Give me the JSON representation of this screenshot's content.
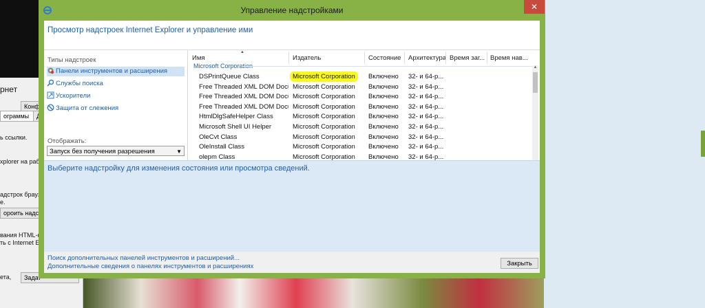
{
  "dialog": {
    "title": "Управление надстройками",
    "heading": "Просмотр надстроек Internet Explorer и управление ими",
    "close_glyph": "✕"
  },
  "left_pane": {
    "title": "Типы надстроек",
    "items": [
      {
        "label": "Панели инструментов и расширения",
        "icon": "gear-icon",
        "selected": true
      },
      {
        "label": "Службы поиска",
        "icon": "search-icon",
        "selected": false
      },
      {
        "label": "Ускорители",
        "icon": "accelerator-icon",
        "selected": false
      },
      {
        "label": "Защита от слежения",
        "icon": "no-entry-icon",
        "selected": false
      }
    ],
    "show_label": "Отображать:",
    "show_value": "Запуск без получения разрешения"
  },
  "table": {
    "columns": [
      "Имя",
      "Издатель",
      "Состояние",
      "Архитектура",
      "Время заг...",
      "Время нав..."
    ],
    "group": "Microsoft Corporation",
    "rows": [
      {
        "name": "DSPrintQueue Class",
        "publisher": "Microsoft Corporation",
        "status": "Включено",
        "arch": "32- и 64-р...",
        "highlight": true
      },
      {
        "name": "Free Threaded XML DOM Docu...",
        "publisher": "Microsoft Corporation",
        "status": "Включено",
        "arch": "32- и 64-р..."
      },
      {
        "name": "Free Threaded XML DOM Docu...",
        "publisher": "Microsoft Corporation",
        "status": "Включено",
        "arch": "32- и 64-р..."
      },
      {
        "name": "Free Threaded XML DOM Docu...",
        "publisher": "Microsoft Corporation",
        "status": "Включено",
        "arch": "32- и 64-р..."
      },
      {
        "name": "HtmlDlgSafeHelper Class",
        "publisher": "Microsoft Corporation",
        "status": "Включено",
        "arch": "32- и 64-р..."
      },
      {
        "name": "Microsoft Shell UI Helper",
        "publisher": "Microsoft Corporation",
        "status": "Включено",
        "arch": "32- и 64-р..."
      },
      {
        "name": "OleCvt Class",
        "publisher": "Microsoft Corporation",
        "status": "Включено",
        "arch": "32- и 64-р..."
      },
      {
        "name": "OleInstall Class",
        "publisher": "Microsoft Corporation",
        "status": "Включено",
        "arch": "32- и 64-р..."
      },
      {
        "name": "olepm Class",
        "publisher": "Microsoft Corporation",
        "status": "Включено",
        "arch": "32- и 64-р..."
      }
    ]
  },
  "details": {
    "message": "Выберите надстройку для изменения состояния или просмотра сведений."
  },
  "footer": {
    "link1": "Поиск дополнительных панелей инструментов и расширений...",
    "link2": "Дополнительные сведения о панелях инструментов и расширениях",
    "close_label": "Закрыть"
  },
  "background_window": {
    "fragments": [
      "рнет",
      "Конфиден",
      "ограммы",
      "Д",
      "ь ссылки.",
      "xplorer на рабо",
      "адстрок браузе",
      "е.",
      "ороить надстро",
      "вания HTML-фа",
      "ть с Internet Exp",
      "ета,",
      "Задат"
    ]
  },
  "colors": {
    "accent_green": "#89b246",
    "link_blue": "#1e5fb2",
    "highlight_yellow": "#fafa1e",
    "close_red": "#c74a3c"
  }
}
